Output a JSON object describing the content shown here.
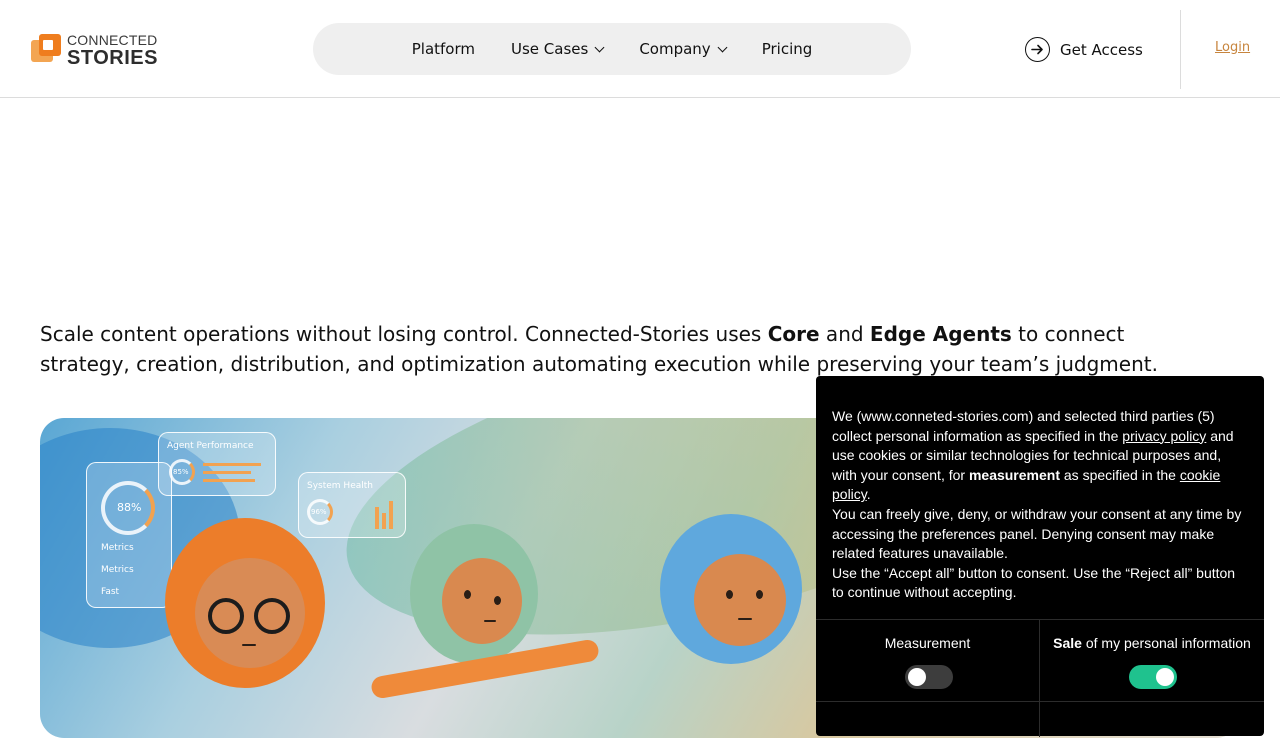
{
  "header": {
    "logo": {
      "line1": "CONNECTED",
      "line2": "STORIES"
    },
    "nav": [
      {
        "label": "Platform"
      },
      {
        "label": "Use Cases"
      },
      {
        "label": "Company"
      },
      {
        "label": "Pricing"
      }
    ],
    "get_access_label": "Get Access",
    "login_label": "Login"
  },
  "intro": {
    "text_1": "Scale content operations without losing control. Connected-Stories uses ",
    "bold_1": "Core",
    "text_2": " and ",
    "bold_2": "Edge Agents",
    "text_3": " to connect strategy, creation, distribution, and optimization automating execution while preserving your team’s judgment."
  },
  "hero": {
    "panel_agent_performance": "Agent Performance",
    "panel_agent_value": "85%",
    "panel_system_health": "System Health",
    "panel_system_value": "96%",
    "panel_metrics_value": "88%",
    "panel_metrics_rows": [
      "Metrics",
      "Metrics",
      "Fast"
    ]
  },
  "cookie": {
    "p1_a": "We (www.conneted-stories.com) and selected third parties (5) collect personal information as specified in the ",
    "p1_link1": "privacy policy",
    "p1_b": " and use cookies or similar technologies for technical purposes and, with your consent, for ",
    "p1_bold": "measurement",
    "p1_c": " as specified in the ",
    "p1_link2": "cookie policy",
    "p1_d": ".",
    "p2": "You can freely give, deny, or withdraw your consent at any time by accessing the preferences panel. Denying consent may make related features unavailable.",
    "p3": "Use the “Accept all” button to consent. Use the “Reject all” button to continue without accepting.",
    "toggles": [
      {
        "label": "Measurement",
        "state": "off"
      },
      {
        "label_bold": "Sale",
        "label_rest": " of my personal information",
        "state": "on"
      }
    ],
    "toggle_on_color": "#1fc28e"
  }
}
